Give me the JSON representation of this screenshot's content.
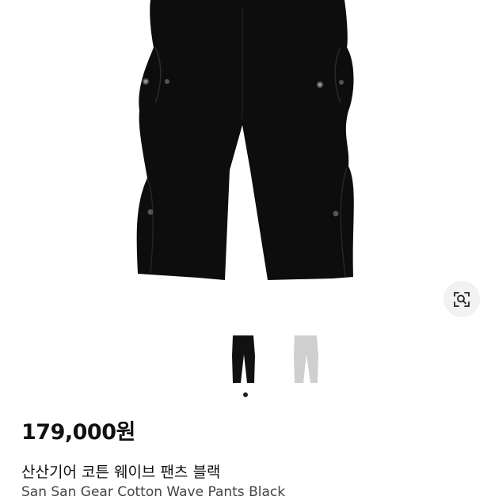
{
  "product": {
    "price": "179,000원",
    "name_ko": "산산기어 코튼 웨이브 팬츠 블랙",
    "name_en": "San San Gear Cotton Wave Pants Black"
  },
  "gallery": {
    "image_subject": "black cotton wave pants",
    "thumbnails": [
      {
        "color_name": "black",
        "color": "#111111"
      },
      {
        "color_name": "grey",
        "color": "#cfcfcf"
      }
    ],
    "current_page": 1,
    "page_count": 1
  },
  "icons": {
    "lens": "image-search-icon"
  },
  "colors": {
    "pants": "#0d0d0d",
    "button_bg": "#f2f2f2",
    "dot_active": "#222222"
  }
}
